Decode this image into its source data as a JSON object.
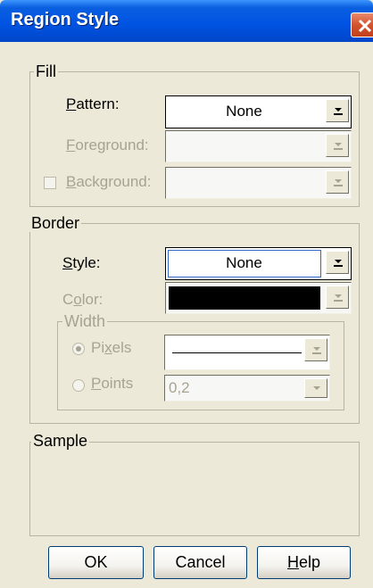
{
  "window": {
    "title": "Region Style"
  },
  "fill": {
    "legend": "Fill",
    "pattern": {
      "label_u": "P",
      "label_rest": "attern:",
      "value": "None"
    },
    "foreground": {
      "label_u": "F",
      "label_rest": "oreground:"
    },
    "background": {
      "label_u": "B",
      "label_rest": "ackground:",
      "checked": false
    }
  },
  "border": {
    "legend": "Border",
    "style": {
      "label_u": "S",
      "label_rest": "tyle:",
      "value": "None"
    },
    "color": {
      "label_pre": "C",
      "label_u": "o",
      "label_rest": "lor:",
      "value_color": "#000000"
    },
    "width": {
      "legend": "Width",
      "pixels": {
        "label_pre": "Pi",
        "label_u": "x",
        "label_rest": "els",
        "selected": true
      },
      "points": {
        "label_u": "P",
        "label_rest": "oints",
        "value": "0,2",
        "selected": false
      }
    }
  },
  "sample": {
    "legend": "Sample"
  },
  "buttons": {
    "ok": "OK",
    "cancel": "Cancel",
    "help_u": "H",
    "help_rest": "elp"
  },
  "colors": {
    "titlebar": "#0054e3",
    "dialog_bg": "#ece9d8",
    "disabled_text": "#a7a393"
  }
}
